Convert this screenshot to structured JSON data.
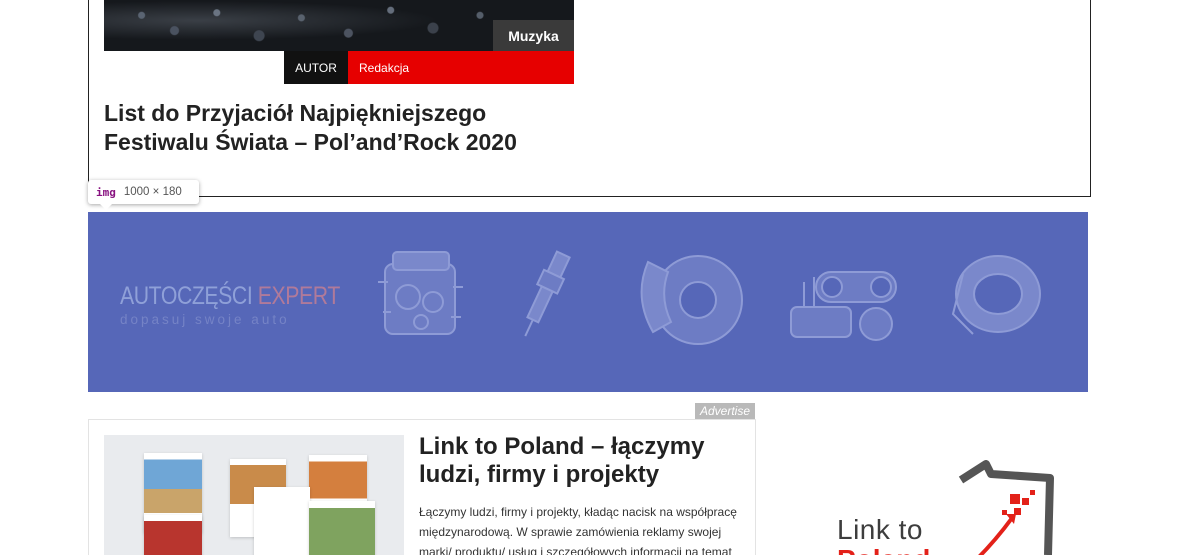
{
  "top_article": {
    "category": "Muzyka",
    "author_label": "AUTOR",
    "author_name": "Redakcja",
    "title": "List do Przyjaciół Najpiękniejszego Festiwalu Świata – Pol’and’Rock 2020"
  },
  "devtools_tooltip": {
    "tag": "img",
    "size": "1000 × 180"
  },
  "banner": {
    "brand_part1": "AUTOCZĘŚCI",
    "brand_part2": " EXPERT",
    "tagline": "dopasuj swoje auto",
    "background_color": "#5667b8",
    "parts": [
      "engine-icon",
      "spark-plug-icon",
      "brake-disc-icon",
      "timing-belt-icon",
      "air-filter-icon"
    ]
  },
  "ad": {
    "label": "Advertise",
    "title": "Link to Poland – łączymy ludzi, firmy i projekty",
    "text": "Łączymy ludzi, firmy i projekty, kładąc nacisk na współpracę międzynarodową. W sprawie zamówienia reklamy swojej marki/ produktu/ usług i szczegółowych informacji na temat"
  },
  "sidebar_logo": {
    "line1": "Link to",
    "line2": "Poland",
    "accent_color": "#e32119"
  }
}
